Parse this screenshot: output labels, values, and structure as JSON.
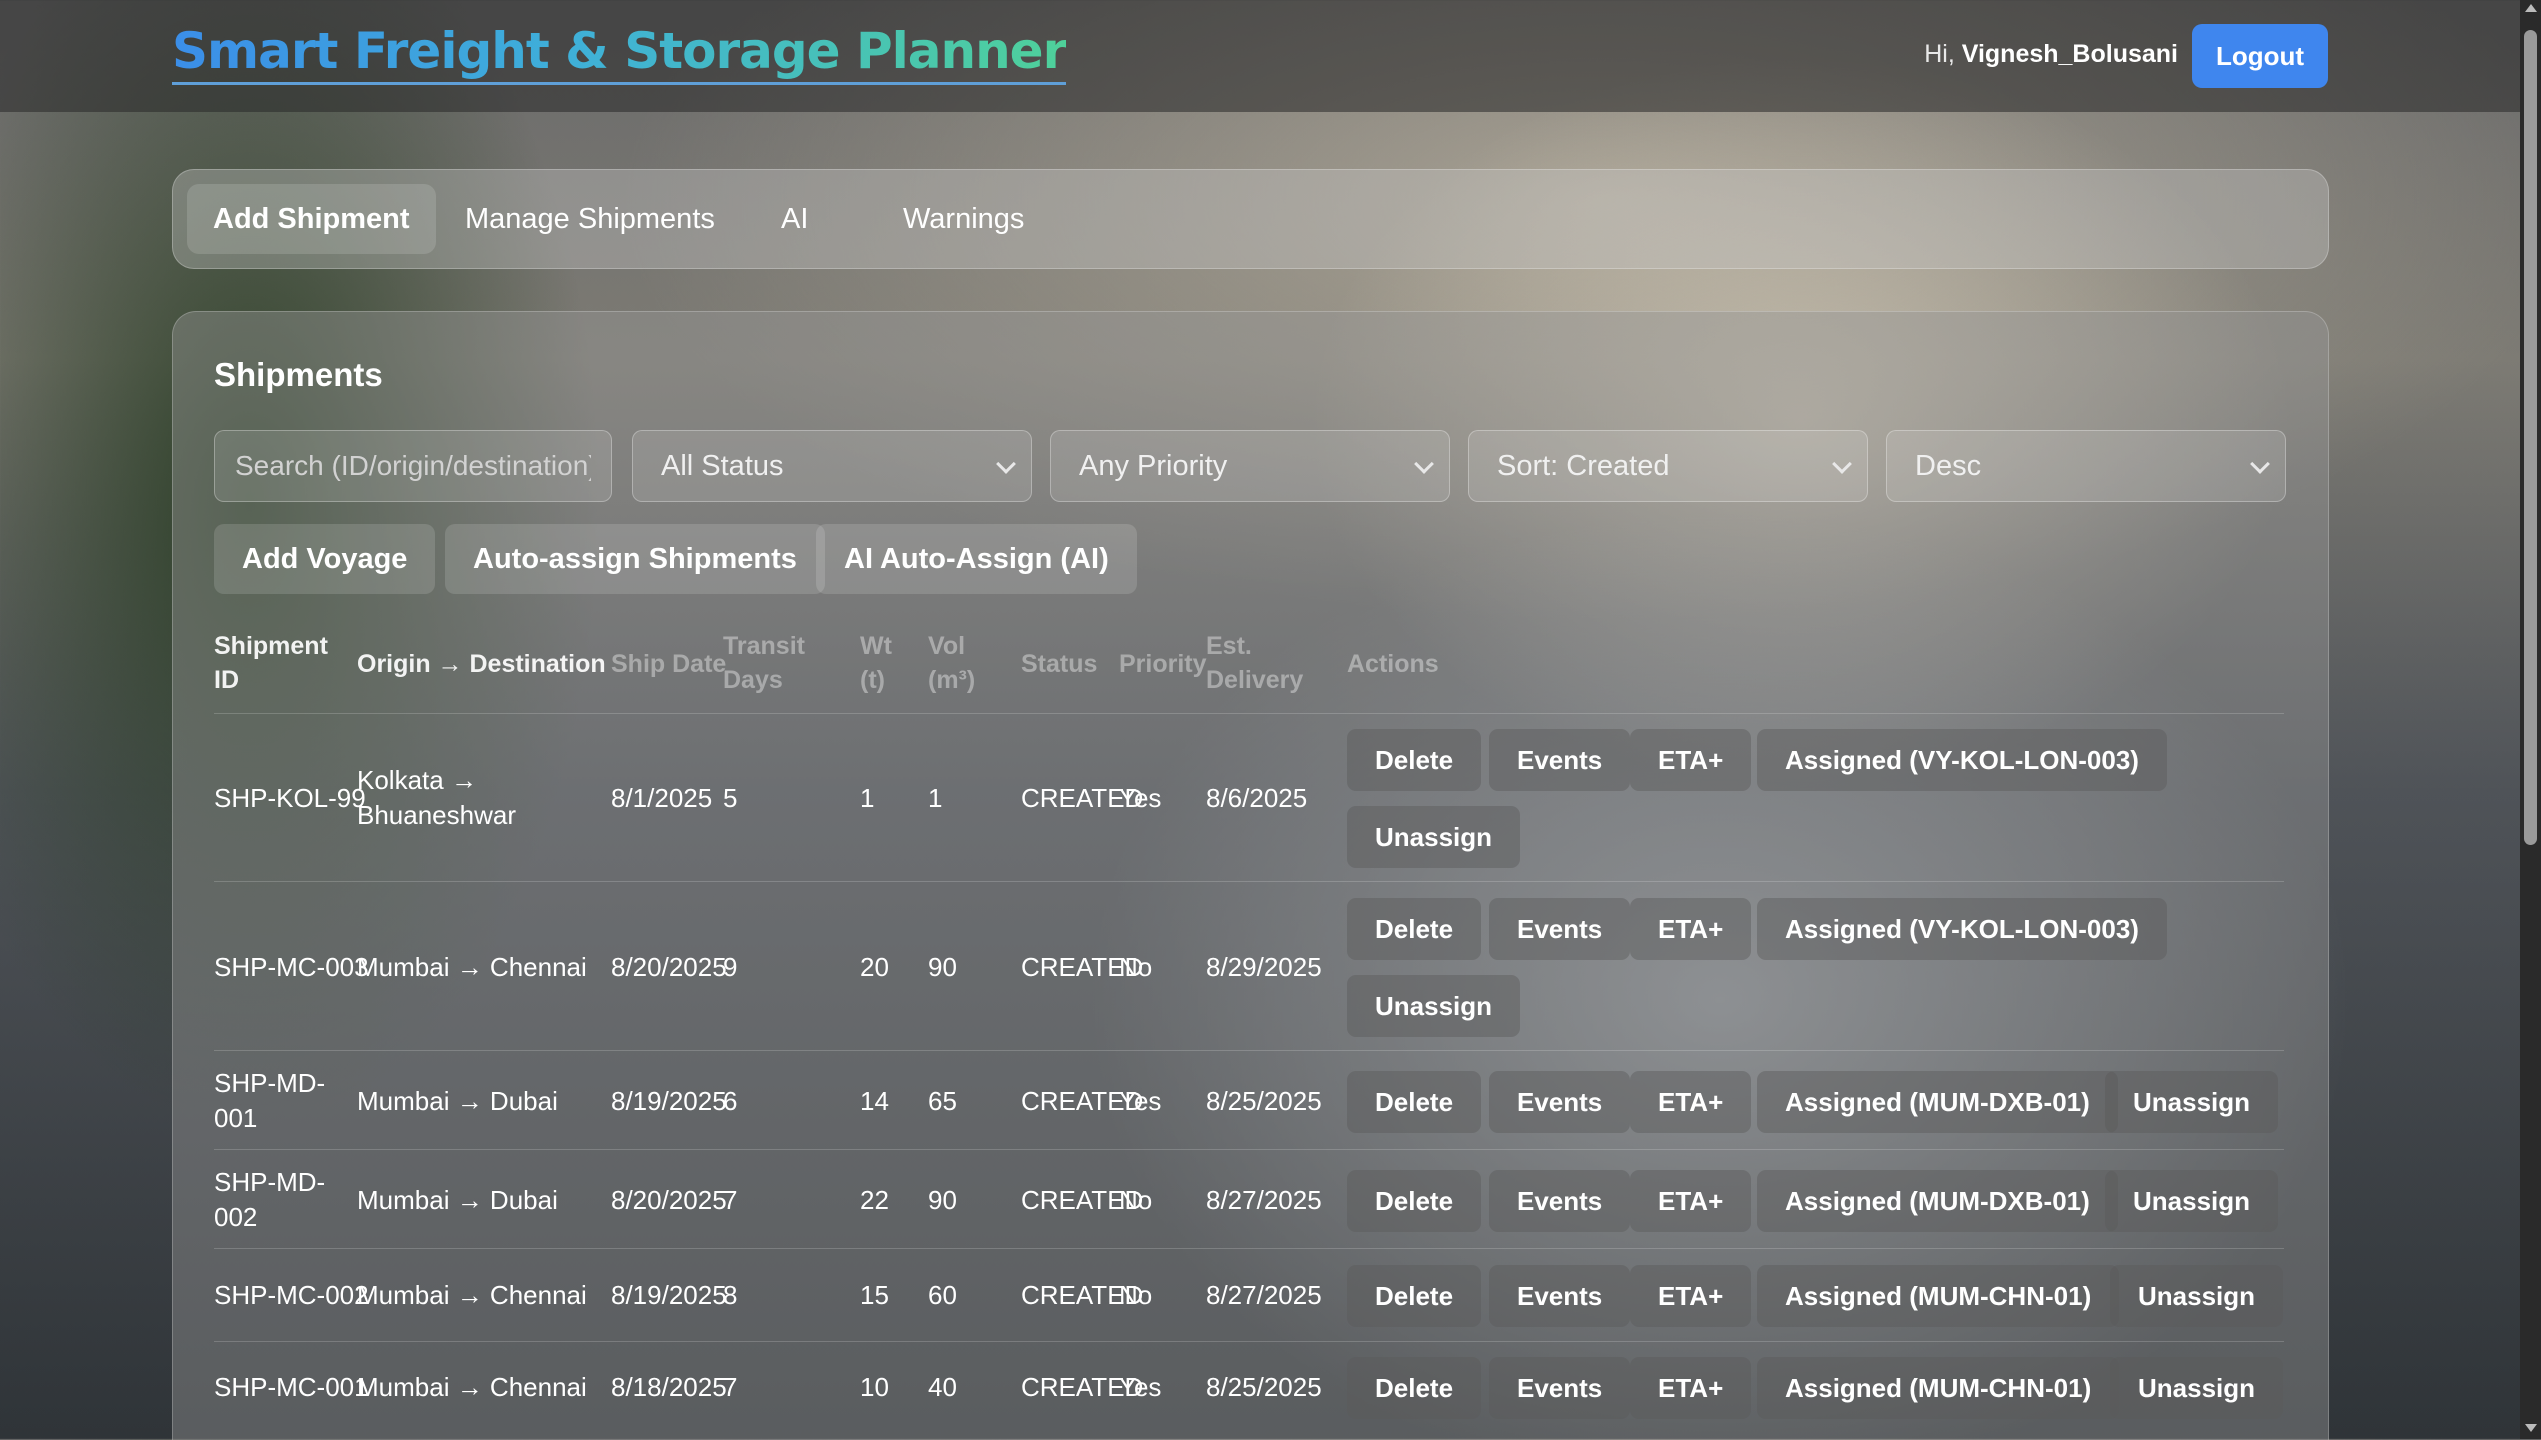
{
  "header": {
    "title": "Smart Freight & Storage Planner",
    "greeting": "Hi,",
    "username": "Vignesh_Bolusani",
    "logout_label": "Logout"
  },
  "tabs": [
    {
      "label": "Add Shipment",
      "active": true
    },
    {
      "label": "Manage Shipments",
      "active": false
    },
    {
      "label": "AI",
      "active": false
    },
    {
      "label": "Warnings",
      "active": false
    }
  ],
  "shipments": {
    "title": "Shipments",
    "search_placeholder": "Search (ID/origin/destination)",
    "filters": {
      "status": "All Status",
      "priority": "Any Priority",
      "sort": "Sort: Created",
      "order": "Desc"
    },
    "actions": {
      "add_voyage": "Add Voyage",
      "auto_assign": "Auto-assign Shipments",
      "ai_auto_assign": "AI Auto-Assign (AI)"
    },
    "columns": {
      "id": [
        "Shipment",
        "ID"
      ],
      "route": "Origin → Destination",
      "ship_date": "Ship Date",
      "transit": [
        "Transit",
        "Days"
      ],
      "wt": [
        "Wt",
        "(t)"
      ],
      "vol": [
        "Vol",
        "(m³)"
      ],
      "status": "Status",
      "priority": "Priority",
      "eta": [
        "Est.",
        "Delivery"
      ],
      "actions": "Actions"
    },
    "button_labels": {
      "delete": "Delete",
      "events": "Events",
      "eta_plus": "ETA+",
      "unassign": "Unassign"
    },
    "rows": [
      {
        "id": "SHP-KOL-99",
        "route": "Kolkata → Bhuaneshwar",
        "ship_date": "8/1/2025",
        "transit": "5",
        "wt": "1",
        "vol": "1",
        "status": "CREATED",
        "priority": "Yes",
        "eta": "8/6/2025",
        "assigned": "Assigned (VY-KOL-LON-003)"
      },
      {
        "id": "SHP-MC-003",
        "route": "Mumbai → Chennai",
        "ship_date": "8/20/2025",
        "transit": "9",
        "wt": "20",
        "vol": "90",
        "status": "CREATED",
        "priority": "No",
        "eta": "8/29/2025",
        "assigned": "Assigned (VY-KOL-LON-003)"
      },
      {
        "id": "SHP-MD-001",
        "route": "Mumbai → Dubai",
        "ship_date": "8/19/2025",
        "transit": "6",
        "wt": "14",
        "vol": "65",
        "status": "CREATED",
        "priority": "Yes",
        "eta": "8/25/2025",
        "assigned": "Assigned (MUM-DXB-01)"
      },
      {
        "id": "SHP-MD-002",
        "route": "Mumbai → Dubai",
        "ship_date": "8/20/2025",
        "transit": "7",
        "wt": "22",
        "vol": "90",
        "status": "CREATED",
        "priority": "No",
        "eta": "8/27/2025",
        "assigned": "Assigned (MUM-DXB-01)"
      },
      {
        "id": "SHP-MC-002",
        "route": "Mumbai → Chennai",
        "ship_date": "8/19/2025",
        "transit": "8",
        "wt": "15",
        "vol": "60",
        "status": "CREATED",
        "priority": "No",
        "eta": "8/27/2025",
        "assigned": "Assigned (MUM-CHN-01)"
      },
      {
        "id": "SHP-MC-001",
        "route": "Mumbai → Chennai",
        "ship_date": "8/18/2025",
        "transit": "7",
        "wt": "10",
        "vol": "40",
        "status": "CREATED",
        "priority": "Yes",
        "eta": "8/25/2025",
        "assigned": "Assigned (MUM-CHN-01)"
      }
    ]
  }
}
